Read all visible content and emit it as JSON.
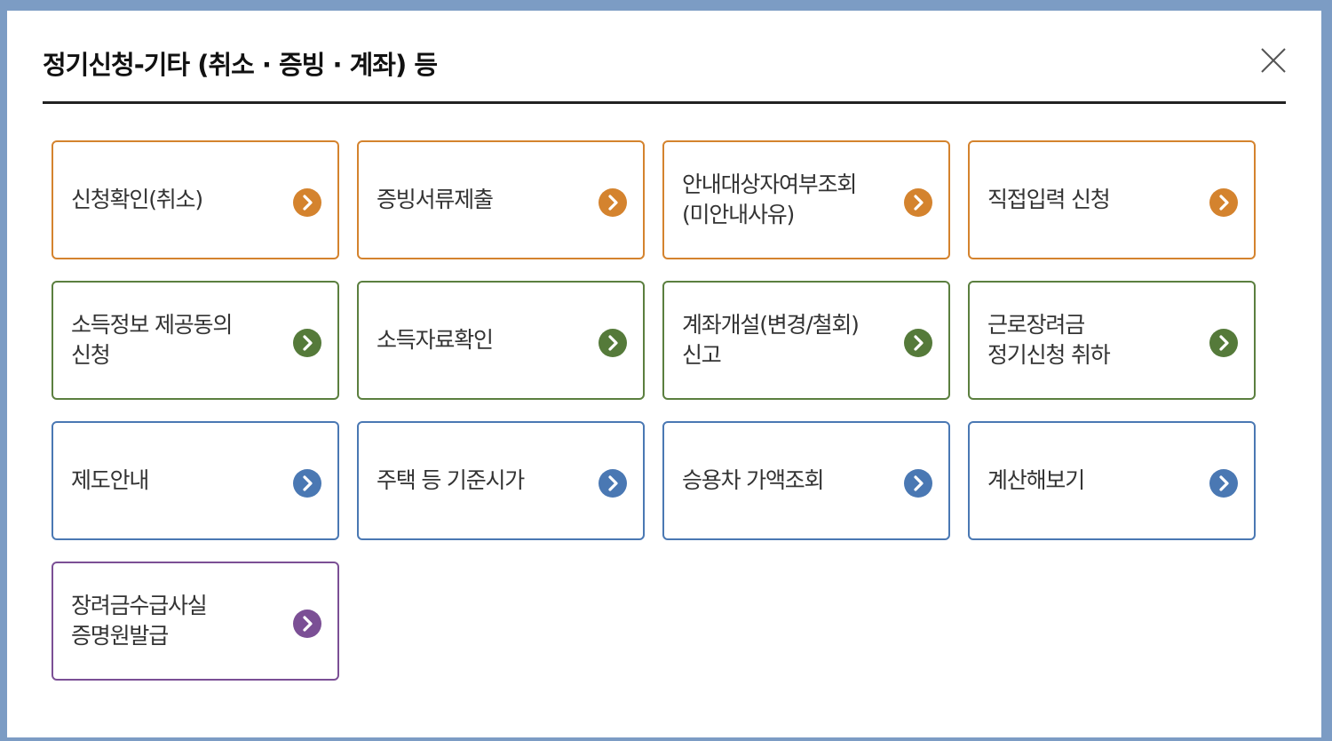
{
  "dialog": {
    "title": "정기신청-기타 (취소 · 증빙 · 계좌) 등",
    "close_icon": "close-icon"
  },
  "colors": {
    "orange": "#d4832e",
    "green": "#557a3a",
    "blue": "#4a78b3",
    "purple": "#7b4f95"
  },
  "menu": [
    {
      "label": "신청확인(취소)",
      "color": "orange",
      "icon": "chevron-right-circle-icon"
    },
    {
      "label": "증빙서류제출",
      "color": "orange",
      "icon": "chevron-right-circle-icon"
    },
    {
      "label": "안내대상자여부조회\n(미안내사유)",
      "color": "orange",
      "icon": "chevron-right-circle-icon"
    },
    {
      "label": "직접입력 신청",
      "color": "orange",
      "icon": "chevron-right-circle-icon"
    },
    {
      "label": "소득정보 제공동의\n신청",
      "color": "green",
      "icon": "chevron-right-circle-icon"
    },
    {
      "label": "소득자료확인",
      "color": "green",
      "icon": "chevron-right-circle-icon"
    },
    {
      "label": "계좌개설(변경/철회)\n신고",
      "color": "green",
      "icon": "chevron-right-circle-icon"
    },
    {
      "label": "근로장려금\n정기신청 취하",
      "color": "green",
      "icon": "chevron-right-circle-icon"
    },
    {
      "label": "제도안내",
      "color": "blue",
      "icon": "chevron-right-circle-icon"
    },
    {
      "label": "주택 등 기준시가",
      "color": "blue",
      "icon": "chevron-right-circle-icon"
    },
    {
      "label": "승용차 가액조회",
      "color": "blue",
      "icon": "chevron-right-circle-icon"
    },
    {
      "label": "계산해보기",
      "color": "blue",
      "icon": "chevron-right-circle-icon"
    },
    {
      "label": "장려금수급사실\n증명원발급",
      "color": "purple",
      "icon": "chevron-right-circle-icon"
    }
  ]
}
